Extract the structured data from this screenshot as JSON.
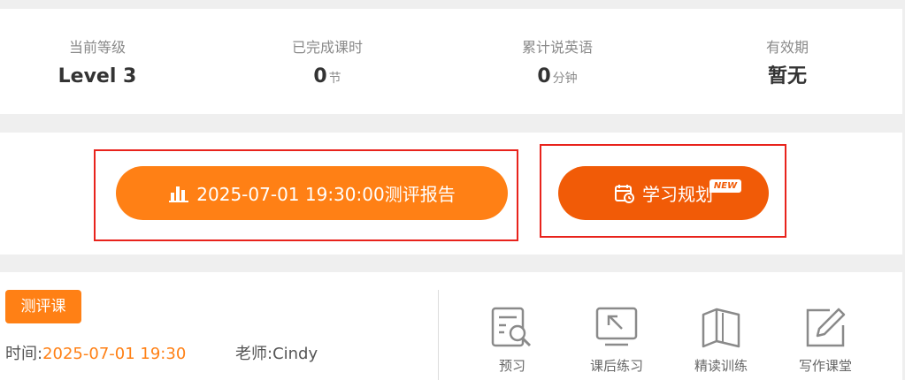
{
  "stats": [
    {
      "label": "当前等级",
      "value": "Level 3",
      "unit": ""
    },
    {
      "label": "已完成课时",
      "value": "0",
      "unit": "节"
    },
    {
      "label": "累计说英语",
      "value": "0",
      "unit": "分钟"
    },
    {
      "label": "有效期",
      "value": "暂无",
      "unit": ""
    }
  ],
  "actions": {
    "report_label": "2025-07-01 19:30:00测评报告",
    "report_icon": "bar-chart-icon",
    "plan_label": "学习规划",
    "plan_icon": "calendar-clock-icon",
    "plan_badge": "NEW"
  },
  "lesson": {
    "tag": "测评课",
    "time_label": "时间:",
    "time_value": "2025-07-01 19:30",
    "teacher_label": "老师:",
    "teacher_value": "Cindy",
    "tools": [
      {
        "label": "预习",
        "icon": "preview-doc-search-icon"
      },
      {
        "label": "课后练习",
        "icon": "exercise-arrow-icon"
      },
      {
        "label": "精读训练",
        "icon": "book-icon"
      },
      {
        "label": "写作课堂",
        "icon": "pencil-edit-icon"
      }
    ]
  },
  "colors": {
    "orange": "#ff8015",
    "deep_orange": "#f15b07",
    "highlight_red": "#e8231c"
  }
}
